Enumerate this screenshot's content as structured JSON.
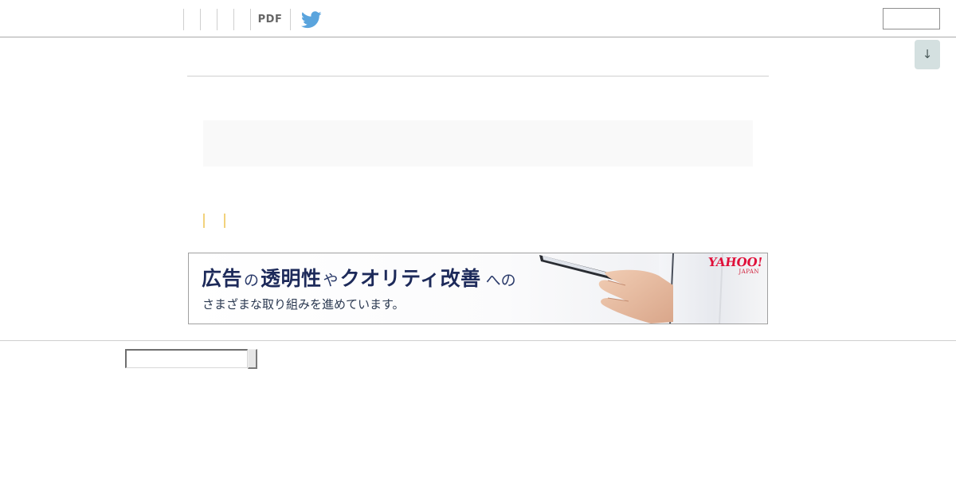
{
  "topbar": {
    "pdf_label": "PDF",
    "twitter_icon": "twitter-bird-icon",
    "twitter_color": "#5aa4dd",
    "search_value": ""
  },
  "scroll_button": {
    "label": "↓",
    "color": "#d4e0e0"
  },
  "ad": {
    "headline_parts": [
      "広告",
      "の",
      "透明性",
      "や",
      "クオリティ改善",
      "への"
    ],
    "subtitle": "さまざまな取り組みを進めています。",
    "logo_text": "YAHOO!",
    "logo_sub": "JAPAN",
    "logo_color": "#e0103a",
    "headline_color": "#1d2a5a",
    "image": "hand-holding-tablet-photo"
  },
  "footer": {
    "input_value": "",
    "button_label": ""
  },
  "colors": {
    "divider": "#cfcfcf",
    "accent_tick": "#f2d27c",
    "panel_bg": "#f9f9f9"
  }
}
